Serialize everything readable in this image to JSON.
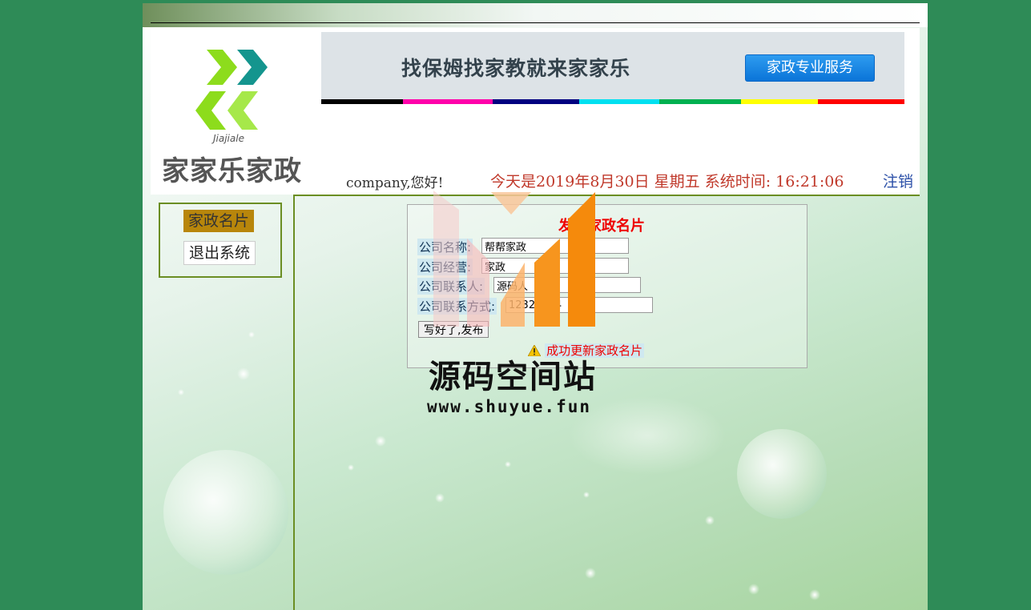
{
  "brand": {
    "logo_sub": "Jiajiale",
    "logo_text": "家家乐家政"
  },
  "banner": {
    "slogan": "找保姆找家教就来家家乐",
    "button_label": "家政专业服务",
    "stripe_colors": [
      "#000000",
      "#ff00aa",
      "#000080",
      "#00e0f0",
      "#00b050",
      "#ffff00",
      "#ff0000"
    ]
  },
  "info": {
    "greeting": "company,您好!",
    "datetime": "今天是2019年8月30日 星期五 系统时间: 16:21:06",
    "logout_label": "注销"
  },
  "sidebar": {
    "items": [
      {
        "label": "家政名片"
      },
      {
        "label": "退出系统"
      }
    ]
  },
  "form": {
    "title": "发布家政名片",
    "fields": [
      {
        "label": "公司名称:",
        "value": "帮帮家政"
      },
      {
        "label": "公司经营:",
        "value": "家政"
      },
      {
        "label": "公司联系人:",
        "value": "源码人"
      },
      {
        "label": "公司联系方式:",
        "value": "12325454"
      }
    ],
    "submit_label": "写好了,发布",
    "status_message": "成功更新家政名片"
  },
  "watermark": {
    "title": "源码空间站",
    "url": "www.shuyue.fun"
  },
  "colors": {
    "page_bg": "#2e8b57",
    "frame_line": "#6b8e23",
    "sidebar_active": "#b8860b",
    "date_text": "#c0392b",
    "logout_text": "#2c50a8",
    "form_title": "#ee0000"
  }
}
